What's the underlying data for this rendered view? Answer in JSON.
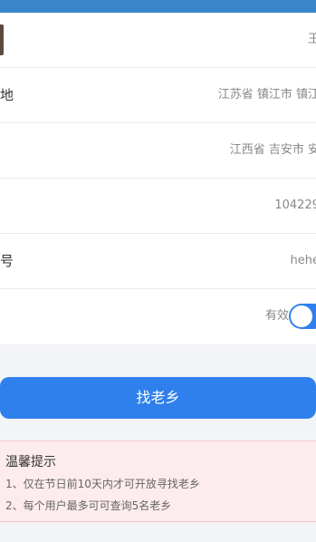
{
  "profile": {
    "name_value": "王",
    "hometown_label": "地",
    "hometown_value": "江苏省 镇江市 镇江",
    "residence_label": "",
    "residence_value": "江西省 吉安市 安",
    "id_value": "104229",
    "account_label": "号",
    "account_value": "hehe",
    "status_label": "",
    "status_value": "有效"
  },
  "actions": {
    "find_button": "找老乡"
  },
  "tips": {
    "title": "温馨提示",
    "items": [
      "1、仅在节日前10天内才可开放寻找老乡",
      "2、每个用户最多可可查询5名老乡"
    ]
  },
  "colors": {
    "accent": "#2f80ed",
    "topbar": "#3a86c8",
    "tips_bg": "#fdeced"
  }
}
